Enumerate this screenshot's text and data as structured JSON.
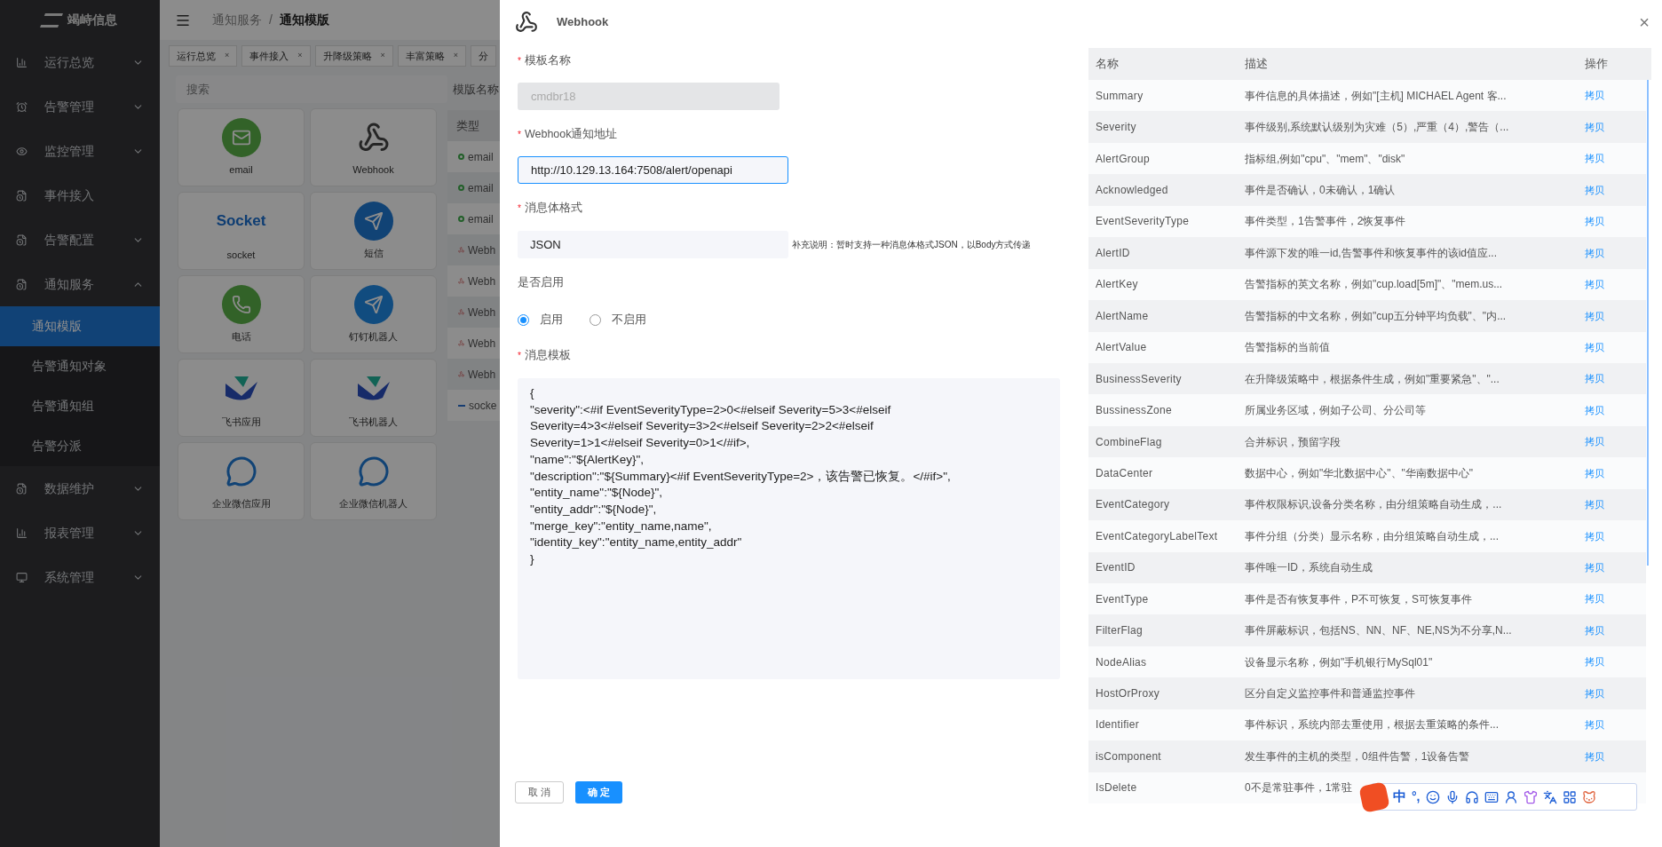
{
  "sidebar": {
    "logo": "竭峙信息",
    "items": [
      {
        "label": "运行总览",
        "expanded": false
      },
      {
        "label": "告警管理",
        "expanded": false
      },
      {
        "label": "监控管理",
        "expanded": false
      },
      {
        "label": "事件接入"
      },
      {
        "label": "告警配置",
        "expanded": false
      },
      {
        "label": "通知服务",
        "expanded": true,
        "children": [
          {
            "label": "通知模版",
            "selected": true
          },
          {
            "label": "告警通知对象",
            "selected": false
          },
          {
            "label": "告警通知组",
            "selected": false
          },
          {
            "label": "告警分派",
            "selected": false
          }
        ]
      },
      {
        "label": "数据维护",
        "expanded": false
      },
      {
        "label": "报表管理",
        "expanded": false
      },
      {
        "label": "系统管理",
        "expanded": false
      }
    ]
  },
  "breadcrumb": [
    "通知服务",
    "/",
    "通知模版"
  ],
  "tabs": [
    {
      "label": "运行总览",
      "close": "×"
    },
    {
      "label": "事件接入",
      "close": "×"
    },
    {
      "label": "升降级策略",
      "close": "×"
    },
    {
      "label": "丰富策略",
      "close": "×"
    },
    {
      "label": "分"
    }
  ],
  "search": {
    "placeholder": "搜索"
  },
  "channels": [
    {
      "label": "email"
    },
    {
      "label": "Webhook"
    },
    {
      "label": "socket",
      "logo_text": "Socket"
    },
    {
      "label": "短信"
    },
    {
      "label": "电话"
    },
    {
      "label": "钉钉机器人"
    },
    {
      "label": "飞书应用"
    },
    {
      "label": "飞书机器人"
    },
    {
      "label": "企业微信应用"
    },
    {
      "label": "企业微信机器人"
    }
  ],
  "template_list": {
    "name_label": "模版名称",
    "column_1": "类型",
    "rows": [
      {
        "kind": "email",
        "label": "email"
      },
      {
        "kind": "email",
        "label": "email"
      },
      {
        "kind": "email",
        "label": "email"
      },
      {
        "kind": "webhook",
        "label": "Webh"
      },
      {
        "kind": "webhook",
        "label": "Webh"
      },
      {
        "kind": "webhook",
        "label": "Webh"
      },
      {
        "kind": "webhook",
        "label": "Webh"
      },
      {
        "kind": "webhook",
        "label": "Webh"
      },
      {
        "kind": "socket",
        "label": "socke"
      }
    ]
  },
  "drawer": {
    "title": "Webhook",
    "close": "×",
    "fields": [
      {
        "kind": "input",
        "label": "模板名称",
        "mark": "*",
        "value": "cmdbr18",
        "disabled": true,
        "focused": false
      },
      {
        "kind": "input",
        "label": "Webhook通知地址",
        "mark": "*",
        "value": "http://10.129.13.164:7508/alert/openapi",
        "disabled": false,
        "focused": true
      },
      {
        "kind": "select",
        "label": "消息体格式",
        "mark": "*",
        "value": "JSON",
        "hint": "补充说明：暂时支持一种消息体格式JSON，以Body方式传递"
      },
      {
        "kind": "radio",
        "label": "是否启用",
        "options": [
          {
            "label": "启用",
            "selected": true
          },
          {
            "label": "不启用",
            "selected": false
          }
        ]
      },
      {
        "kind": "textarea",
        "label": "消息模板",
        "mark": "*",
        "lines": [
          "{",
          "\"severity\":<#if EventSeverityType=2>0<#elseif Severity=5>3<#elseif",
          "Severity=4>3<#elseif Severity=3>2<#elseif Severity=2>2<#elseif",
          "Severity=1>1<#elseif Severity=0>1</#if>,",
          "\"name\":\"${AlertKey}\",",
          "\"description\":\"${Summary}<#if EventSeverityType=2>，该告警已恢复。</#if>\",",
          "\"entity_name\":\"${Node}\",",
          "\"entity_addr\":\"${Node}\",",
          "\"merge_key\":\"entity_name,name\",",
          "\"identity_key\":\"entity_name,entity_addr\"",
          "}"
        ]
      }
    ],
    "buttons": [
      {
        "kind": "default",
        "label": "取 消"
      },
      {
        "kind": "primary",
        "label": "确 定"
      }
    ],
    "variables": {
      "columns": [
        "名称",
        "描述",
        "操作"
      ],
      "rows": [
        {
          "name": "Summary",
          "description": "事件信息的具体描述，例如\"[主机] MICHAEL Agent 客...",
          "action": "拷贝"
        },
        {
          "name": "Severity",
          "description": "事件级别,系统默认级别为灾难（5）,严重（4）,警告（...",
          "action": "拷贝"
        },
        {
          "name": "AlertGroup",
          "description": "指标组,例如\"cpu\"、\"mem\"、\"disk\"",
          "action": "拷贝"
        },
        {
          "name": "Acknowledged",
          "description": "事件是否确认，0未确认，1确认",
          "action": "拷贝"
        },
        {
          "name": "EventSeverityType",
          "description": "事件类型，1告警事件，2恢复事件",
          "action": "拷贝"
        },
        {
          "name": "AlertID",
          "description": "事件源下发的唯一id,告警事件和恢复事件的该id值应...",
          "action": "拷贝"
        },
        {
          "name": "AlertKey",
          "description": "告警指标的英文名称，例如\"cup.load[5m]\"、\"mem.us...",
          "action": "拷贝"
        },
        {
          "name": "AlertName",
          "description": "告警指标的中文名称，例如\"cup五分钟平均负载\"、\"内...",
          "action": "拷贝"
        },
        {
          "name": "AlertValue",
          "description": "告警指标的当前值",
          "action": "拷贝"
        },
        {
          "name": "BusinessSeverity",
          "description": "在升降级策略中，根据条件生成，例如\"重要紧急\"、\"...",
          "action": "拷贝"
        },
        {
          "name": "BussinessZone",
          "description": "所属业务区域，例如子公司、分公司等",
          "action": "拷贝"
        },
        {
          "name": "CombineFlag",
          "description": "合并标识，预留字段",
          "action": "拷贝"
        },
        {
          "name": "DataCenter",
          "description": "数据中心，例如\"华北数据中心\"、\"华南数据中心\"",
          "action": "拷贝"
        },
        {
          "name": "EventCategory",
          "description": "事件权限标识,设备分类名称，由分组策略自动生成，...",
          "action": "拷贝"
        },
        {
          "name": "EventCategoryLabelText",
          "description": "事件分组（分类）显示名称，由分组策略自动生成，...",
          "action": "拷贝"
        },
        {
          "name": "EventID",
          "description": "事件唯一ID，系统自动生成",
          "action": "拷贝"
        },
        {
          "name": "EventType",
          "description": "事件是否有恢复事件，P不可恢复，S可恢复事件",
          "action": "拷贝"
        },
        {
          "name": "FilterFlag",
          "description": "事件屏蔽标识，包括NS、NN、NF、NE,NS为不分享,N...",
          "action": "拷贝"
        },
        {
          "name": "NodeAlias",
          "description": "设备显示名称，例如\"手机银行MySql01\"",
          "action": "拷贝"
        },
        {
          "name": "HostOrProxy",
          "description": "区分自定义监控事件和普通监控事件",
          "action": "拷贝"
        },
        {
          "name": "Identifier",
          "description": "事件标识，系统内部去重使用，根据去重策略的条件...",
          "action": "拷贝"
        },
        {
          "name": "isComponent",
          "description": "发生事件的主机的类型，0组件告警，1设备告警",
          "action": "拷贝"
        },
        {
          "name": "IsDelete",
          "description": "0不是常驻事件，1常驻"
        }
      ]
    }
  },
  "ime_toolbar": {
    "mode": "中",
    "punctuation": "°,"
  }
}
